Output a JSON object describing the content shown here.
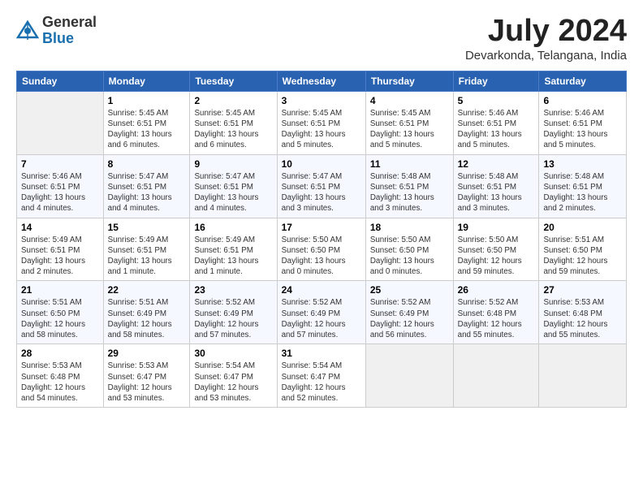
{
  "header": {
    "logo_general": "General",
    "logo_blue": "Blue",
    "month": "July 2024",
    "location": "Devarkonda, Telangana, India"
  },
  "weekdays": [
    "Sunday",
    "Monday",
    "Tuesday",
    "Wednesday",
    "Thursday",
    "Friday",
    "Saturday"
  ],
  "weeks": [
    [
      {
        "day": "",
        "info": ""
      },
      {
        "day": "1",
        "info": "Sunrise: 5:45 AM\nSunset: 6:51 PM\nDaylight: 13 hours\nand 6 minutes."
      },
      {
        "day": "2",
        "info": "Sunrise: 5:45 AM\nSunset: 6:51 PM\nDaylight: 13 hours\nand 6 minutes."
      },
      {
        "day": "3",
        "info": "Sunrise: 5:45 AM\nSunset: 6:51 PM\nDaylight: 13 hours\nand 5 minutes."
      },
      {
        "day": "4",
        "info": "Sunrise: 5:45 AM\nSunset: 6:51 PM\nDaylight: 13 hours\nand 5 minutes."
      },
      {
        "day": "5",
        "info": "Sunrise: 5:46 AM\nSunset: 6:51 PM\nDaylight: 13 hours\nand 5 minutes."
      },
      {
        "day": "6",
        "info": "Sunrise: 5:46 AM\nSunset: 6:51 PM\nDaylight: 13 hours\nand 5 minutes."
      }
    ],
    [
      {
        "day": "7",
        "info": "Sunrise: 5:46 AM\nSunset: 6:51 PM\nDaylight: 13 hours\nand 4 minutes."
      },
      {
        "day": "8",
        "info": "Sunrise: 5:47 AM\nSunset: 6:51 PM\nDaylight: 13 hours\nand 4 minutes."
      },
      {
        "day": "9",
        "info": "Sunrise: 5:47 AM\nSunset: 6:51 PM\nDaylight: 13 hours\nand 4 minutes."
      },
      {
        "day": "10",
        "info": "Sunrise: 5:47 AM\nSunset: 6:51 PM\nDaylight: 13 hours\nand 3 minutes."
      },
      {
        "day": "11",
        "info": "Sunrise: 5:48 AM\nSunset: 6:51 PM\nDaylight: 13 hours\nand 3 minutes."
      },
      {
        "day": "12",
        "info": "Sunrise: 5:48 AM\nSunset: 6:51 PM\nDaylight: 13 hours\nand 3 minutes."
      },
      {
        "day": "13",
        "info": "Sunrise: 5:48 AM\nSunset: 6:51 PM\nDaylight: 13 hours\nand 2 minutes."
      }
    ],
    [
      {
        "day": "14",
        "info": "Sunrise: 5:49 AM\nSunset: 6:51 PM\nDaylight: 13 hours\nand 2 minutes."
      },
      {
        "day": "15",
        "info": "Sunrise: 5:49 AM\nSunset: 6:51 PM\nDaylight: 13 hours\nand 1 minute."
      },
      {
        "day": "16",
        "info": "Sunrise: 5:49 AM\nSunset: 6:51 PM\nDaylight: 13 hours\nand 1 minute."
      },
      {
        "day": "17",
        "info": "Sunrise: 5:50 AM\nSunset: 6:50 PM\nDaylight: 13 hours\nand 0 minutes."
      },
      {
        "day": "18",
        "info": "Sunrise: 5:50 AM\nSunset: 6:50 PM\nDaylight: 13 hours\nand 0 minutes."
      },
      {
        "day": "19",
        "info": "Sunrise: 5:50 AM\nSunset: 6:50 PM\nDaylight: 12 hours\nand 59 minutes."
      },
      {
        "day": "20",
        "info": "Sunrise: 5:51 AM\nSunset: 6:50 PM\nDaylight: 12 hours\nand 59 minutes."
      }
    ],
    [
      {
        "day": "21",
        "info": "Sunrise: 5:51 AM\nSunset: 6:50 PM\nDaylight: 12 hours\nand 58 minutes."
      },
      {
        "day": "22",
        "info": "Sunrise: 5:51 AM\nSunset: 6:49 PM\nDaylight: 12 hours\nand 58 minutes."
      },
      {
        "day": "23",
        "info": "Sunrise: 5:52 AM\nSunset: 6:49 PM\nDaylight: 12 hours\nand 57 minutes."
      },
      {
        "day": "24",
        "info": "Sunrise: 5:52 AM\nSunset: 6:49 PM\nDaylight: 12 hours\nand 57 minutes."
      },
      {
        "day": "25",
        "info": "Sunrise: 5:52 AM\nSunset: 6:49 PM\nDaylight: 12 hours\nand 56 minutes."
      },
      {
        "day": "26",
        "info": "Sunrise: 5:52 AM\nSunset: 6:48 PM\nDaylight: 12 hours\nand 55 minutes."
      },
      {
        "day": "27",
        "info": "Sunrise: 5:53 AM\nSunset: 6:48 PM\nDaylight: 12 hours\nand 55 minutes."
      }
    ],
    [
      {
        "day": "28",
        "info": "Sunrise: 5:53 AM\nSunset: 6:48 PM\nDaylight: 12 hours\nand 54 minutes."
      },
      {
        "day": "29",
        "info": "Sunrise: 5:53 AM\nSunset: 6:47 PM\nDaylight: 12 hours\nand 53 minutes."
      },
      {
        "day": "30",
        "info": "Sunrise: 5:54 AM\nSunset: 6:47 PM\nDaylight: 12 hours\nand 53 minutes."
      },
      {
        "day": "31",
        "info": "Sunrise: 5:54 AM\nSunset: 6:47 PM\nDaylight: 12 hours\nand 52 minutes."
      },
      {
        "day": "",
        "info": ""
      },
      {
        "day": "",
        "info": ""
      },
      {
        "day": "",
        "info": ""
      }
    ]
  ]
}
